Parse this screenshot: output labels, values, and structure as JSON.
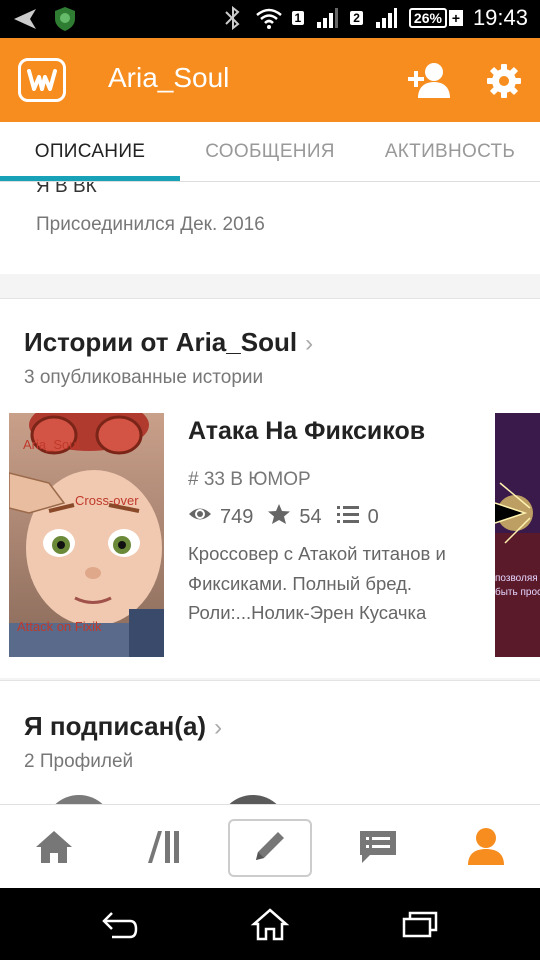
{
  "status_bar": {
    "sim1": "1",
    "sim2": "2",
    "battery": "26%",
    "time": "19:43"
  },
  "app_bar": {
    "title": "Aria_Soul",
    "brand_color": "#f68d1e"
  },
  "tabs": [
    {
      "label": "ОПИСАНИЕ",
      "active": true
    },
    {
      "label": "СООБЩЕНИЯ",
      "active": false
    },
    {
      "label": "АКТИВНОСТЬ",
      "active": false
    }
  ],
  "about": {
    "vk_text": "Я В ВК",
    "joined": "Присоединился Дек. 2016"
  },
  "stories": {
    "title": "Истории от Aria_Soul",
    "subtitle": "3 опубликованные истории",
    "items": [
      {
        "title": "Атака На Фиксиков",
        "rank": "# 33 В ЮМОР",
        "views": "749",
        "votes": "54",
        "parts": "0",
        "description": "Кроссовер с Атакой титанов и Фиксиками. Полный бред. Роли:...Нолик-Эрен Кусачка",
        "cover_texts": [
          "Aria_Soul",
          "Cross-over",
          "Attack on Fixik"
        ]
      }
    ],
    "next_cover_texts": [
      "позволяя",
      "быть прос"
    ]
  },
  "following": {
    "title": "Я подписан(а)",
    "subtitle": "2 Профилей"
  },
  "bottom_nav": [
    "home-icon",
    "library-icon",
    "write-icon",
    "messages-icon",
    "profile-icon"
  ],
  "colors": {
    "accent": "#f68d1e",
    "tab_indicator": "#17a2b8"
  }
}
